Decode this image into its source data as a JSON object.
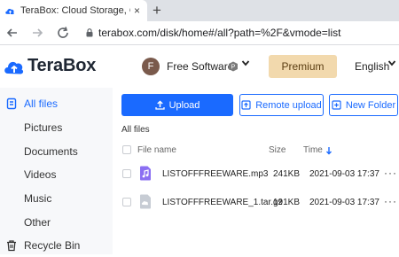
{
  "browser": {
    "tab_title": "TeraBox: Cloud Storage, Cloud Bac",
    "tab_close": "×",
    "new_tab": "+",
    "url": "terabox.com/disk/home#/all?path=%2F&vmode=list"
  },
  "header": {
    "logo_text": "TeraBox",
    "avatar_initial": "F",
    "username": "Free Software",
    "premium_label": "Premium",
    "language": "English"
  },
  "sidebar": {
    "items": [
      {
        "label": "All files",
        "icon": "files-icon",
        "active": true
      },
      {
        "label": "Pictures"
      },
      {
        "label": "Documents"
      },
      {
        "label": "Videos"
      },
      {
        "label": "Music"
      },
      {
        "label": "Other"
      },
      {
        "label": "Recycle Bin",
        "icon": "trash-icon"
      }
    ]
  },
  "toolbar": {
    "upload_label": "Upload",
    "remote_upload_label": "Remote upload",
    "new_folder_label": "New Folder"
  },
  "main": {
    "breadcrumb": "All files",
    "columns": {
      "name": "File name",
      "size": "Size",
      "time": "Time"
    },
    "files": [
      {
        "name": "LISTOFFFREEWARE.mp3",
        "size": "241KB",
        "time": "2021-09-03 17:37",
        "more": "···",
        "icon": "audio-file-icon"
      },
      {
        "name": "LISTOFFFREEWARE_1.tar.gz",
        "size": "191KB",
        "time": "2021-09-03 17:37",
        "more": "···",
        "icon": "archive-file-icon"
      }
    ]
  },
  "colors": {
    "accent": "#1a6aff",
    "premium_bg": "#f2d9ad",
    "sidebar_bg": "#f7f8fa"
  }
}
